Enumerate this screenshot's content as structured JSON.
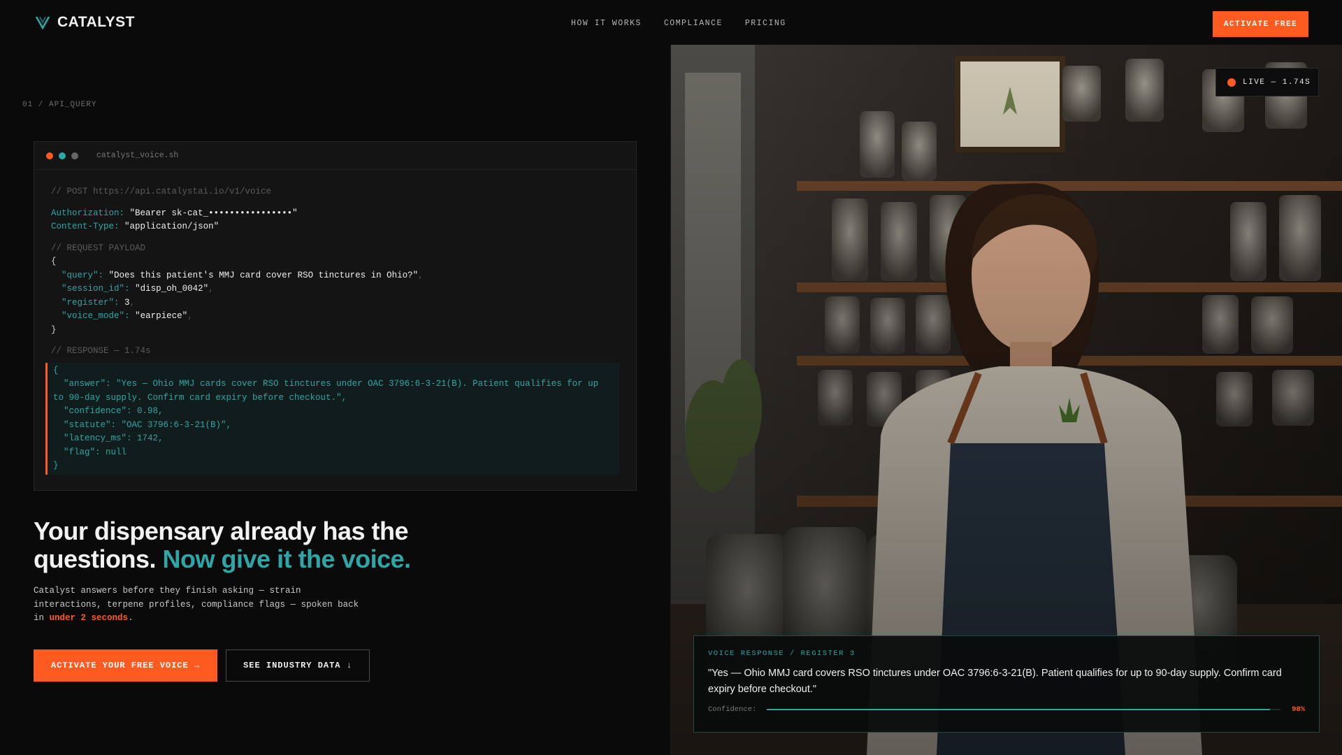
{
  "nav": {
    "brand": "CATALYST",
    "links": [
      "HOW IT WORKS",
      "COMPLIANCE",
      "PRICING"
    ],
    "cta": "ACTIVATE FREE"
  },
  "section_label": "01 / API_QUERY",
  "terminal": {
    "filename": "catalyst_voice.sh",
    "endpoint_comment": "// POST https://api.catalystai.io/v1/voice",
    "auth_key": "Authorization:",
    "auth_val": "\"Bearer sk-cat_••••••••••••••••\"",
    "ctype_key": "Content-Type:",
    "ctype_val": "\"application/json\"",
    "payload_comment": "// REQUEST PAYLOAD",
    "open_brace": "{",
    "close_brace": "}",
    "request": [
      {
        "key": "\"query\":",
        "val": "\"Does this patient's MMJ card cover RSO tinctures in Ohio?\"",
        "comma": ","
      },
      {
        "key": "\"session_id\":",
        "val": "\"disp_oh_0042\"",
        "comma": ","
      },
      {
        "key": "\"register\":",
        "val": "3",
        "comma": ","
      },
      {
        "key": "\"voice_mode\":",
        "val": "\"earpiece\"",
        "comma": ","
      }
    ],
    "response_comment": "// RESPONSE — 1.74s",
    "response": [
      "{",
      "  \"answer\": \"Yes — Ohio MMJ cards cover RSO tinctures under OAC 3796:6-3-21(B). Patient qualifies for up to 90-day supply. Confirm card expiry before checkout.\",",
      "  \"confidence\": 0.98,",
      "  \"statute\": \"OAC 3796:6-3-21(B)\",",
      "  \"latency_ms\": 1742,",
      "  \"flag\": null",
      "}"
    ]
  },
  "hero": {
    "headline_a": "Your dispensary already has the questions.",
    "headline_b": "Now give it the voice.",
    "sub_a": "Catalyst answers before they finish asking — strain interactions, terpene profiles, compliance flags — spoken back in",
    "sub_highlight": "under 2 seconds",
    "sub_end": ".",
    "primary_cta": "ACTIVATE YOUR FREE VOICE →",
    "secondary_cta": "SEE INDUSTRY DATA ↓"
  },
  "live_badge": "LIVE — 1.74S",
  "voice_card": {
    "label": "VOICE RESPONSE / REGISTER 3",
    "text": "\"Yes — Ohio MMJ card covers RSO tinctures under OAC 3796:6-3-21(B). Patient qualifies for up to 90-day supply. Confirm card expiry before checkout.\"",
    "confidence_label": "Confidence:",
    "confidence_pct": "98%",
    "confidence_value": 0.98
  },
  "colors": {
    "accent_orange": "#ff5a1f",
    "accent_teal": "#2ea6a6",
    "dot_red": "#ff5a1f",
    "dot_teal": "#2ea6a6",
    "dot_grey": "#777777"
  },
  "icons": {
    "brand": "catalyst-leaf-icon",
    "live": "live-dot-icon"
  }
}
